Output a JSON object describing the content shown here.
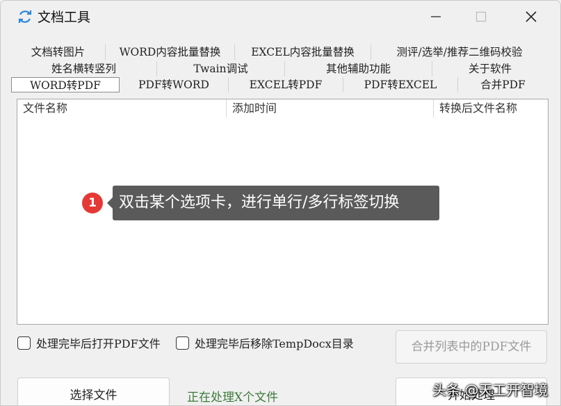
{
  "window": {
    "title": "文档工具"
  },
  "tabs": {
    "row1": [
      "文档转图片",
      "WORD内容批量替换",
      "EXCEL内容批量替换",
      "测评/选举/推荐二维码校验"
    ],
    "row2": [
      "姓名横转竖列",
      "Twain调试",
      "其他辅助功能",
      "关于软件"
    ],
    "row3": [
      "WORD转PDF",
      "PDF转WORD",
      "EXCEL转PDF",
      "PDF转EXCEL",
      "合并PDF"
    ],
    "active": "WORD转PDF"
  },
  "list": {
    "columns": [
      "文件名称",
      "添加时间",
      "转换后文件名称"
    ]
  },
  "tooltip": {
    "badge": "1",
    "text": "双击某个选项卡，进行单行/多行标签切换"
  },
  "options": {
    "open_after": "处理完毕后打开PDF文件",
    "remove_temp": "处理完毕后移除TempDocx目录"
  },
  "buttons": {
    "merge": "合并列表中的PDF文件",
    "select_file": "选择文件",
    "start": "开始处理"
  },
  "status": "正在处理X个文件",
  "watermark": "头条 @天工开智境",
  "colors": {
    "badge": "#e53935",
    "tooltip_bg": "#5a5a5a",
    "status": "#3a7a3a"
  }
}
